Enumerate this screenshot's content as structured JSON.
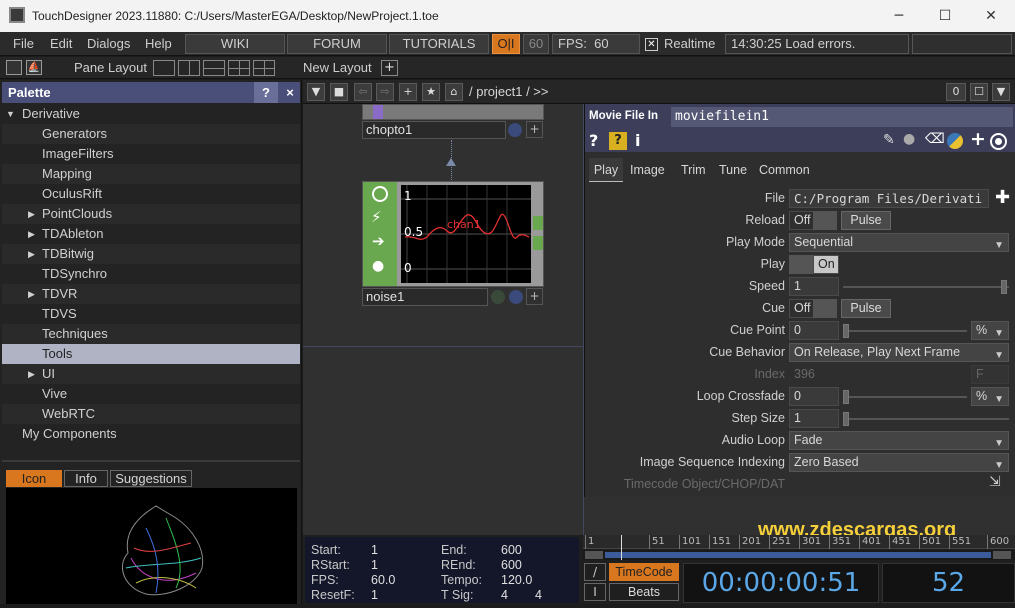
{
  "window": {
    "title": "TouchDesigner 2023.11880: C:/Users/MasterEGA/Desktop/NewProject.1.toe",
    "minimize": "─",
    "maximize": "☐",
    "close": "✕"
  },
  "menu": {
    "items": [
      "File",
      "Edit",
      "Dialogs",
      "Help"
    ],
    "wiki": "WIKI",
    "forum": "FORUM",
    "tutorials": "TUTORIALS",
    "oi": "O|I",
    "fps_cap": "60",
    "fps_label": "FPS:",
    "fps_value": "60",
    "realtime_label": "Realtime",
    "status": "14:30:25 Load errors."
  },
  "toolbar2": {
    "pane_layout": "Pane Layout",
    "new_layout": "New Layout",
    "plus": "+"
  },
  "palette": {
    "title": "Palette",
    "help": "?",
    "close": "×",
    "items": [
      {
        "label": "Derivative",
        "level": 0,
        "arrow": "▼"
      },
      {
        "label": "Generators",
        "level": 1,
        "arrow": ""
      },
      {
        "label": "ImageFilters",
        "level": 1,
        "arrow": ""
      },
      {
        "label": "Mapping",
        "level": 1,
        "arrow": ""
      },
      {
        "label": "OculusRift",
        "level": 1,
        "arrow": ""
      },
      {
        "label": "PointClouds",
        "level": 1,
        "arrow": "▶"
      },
      {
        "label": "TDAbleton",
        "level": 1,
        "arrow": "▶"
      },
      {
        "label": "TDBitwig",
        "level": 1,
        "arrow": "▶"
      },
      {
        "label": "TDSynchro",
        "level": 1,
        "arrow": ""
      },
      {
        "label": "TDVR",
        "level": 1,
        "arrow": "▶"
      },
      {
        "label": "TDVS",
        "level": 1,
        "arrow": ""
      },
      {
        "label": "Techniques",
        "level": 1,
        "arrow": ""
      },
      {
        "label": "Tools",
        "level": 1,
        "arrow": "",
        "selected": true
      },
      {
        "label": "UI",
        "level": 1,
        "arrow": "▶"
      },
      {
        "label": "Vive",
        "level": 1,
        "arrow": ""
      },
      {
        "label": "WebRTC",
        "level": 1,
        "arrow": ""
      },
      {
        "label": "My Components",
        "level": 0,
        "arrow": ""
      }
    ],
    "tabs": [
      "Icon",
      "Info",
      "Suggestions"
    ]
  },
  "network": {
    "path": "/ project1 / >>",
    "count": "0",
    "node_chopto": "chopto1",
    "node_noise": "noise1",
    "channel": "chan1",
    "graph_labels": [
      "1",
      "0.5",
      "0"
    ]
  },
  "params": {
    "op_type": "Movie File In",
    "op_name": "moviefilein1",
    "help": "?",
    "info": "i",
    "tabs": [
      "Play",
      "Image",
      "Trim",
      "Tune",
      "Common"
    ],
    "file_label": "File",
    "file_value": "C:/Program Files/Derivati",
    "reload_label": "Reload",
    "reload_value": "Off",
    "pulse": "Pulse",
    "playmode_label": "Play Mode",
    "playmode_value": "Sequential",
    "play_label": "Play",
    "play_value": "On",
    "speed_label": "Speed",
    "speed_value": "1",
    "cue_label": "Cue",
    "cue_value": "Off",
    "cuepoint_label": "Cue Point",
    "cuepoint_value": "0",
    "cuepoint_unit": "%",
    "cuebehavior_label": "Cue Behavior",
    "cuebehavior_value": "On Release, Play Next Frame",
    "index_label": "Index",
    "index_value": "396",
    "index_unit": "F",
    "loopcross_label": "Loop Crossfade",
    "loopcross_value": "0",
    "loopcross_unit": "%",
    "stepsize_label": "Step Size",
    "stepsize_value": "1",
    "audioloop_label": "Audio Loop",
    "audioloop_value": "Fade",
    "imgseq_label": "Image Sequence Indexing",
    "imgseq_value": "Zero Based",
    "timecode_label": "Timecode Object/CHOP/DAT"
  },
  "timeline": {
    "start_label": "Start:",
    "start": "1",
    "end_label": "End:",
    "end": "600",
    "rstart_label": "RStart:",
    "rstart": "1",
    "rend_label": "REnd:",
    "rend": "600",
    "fps_label": "FPS:",
    "fps": "60.0",
    "tempo_label": "Tempo:",
    "tempo": "120.0",
    "resetf_label": "ResetF:",
    "resetf": "1",
    "tsig_label": "T Sig:",
    "tsig_a": "4",
    "tsig_b": "4",
    "ruler": [
      "1",
      "51",
      "101",
      "151",
      "201",
      "251",
      "301",
      "351",
      "401",
      "451",
      "501",
      "551",
      "600"
    ],
    "timecode_btn": "TimeCode",
    "beats_btn": "Beats",
    "timecode": "00:00:00:51",
    "frame": "52",
    "slash": "/",
    "bar": "I"
  },
  "watermark": "www.zdescargas.org",
  "colors": {
    "accent": "#4a4f7a",
    "chop_green": "#6aa84f",
    "watermark": "#f5d03a",
    "timecode": "#5aa8e8",
    "orange": "#d9771e"
  }
}
